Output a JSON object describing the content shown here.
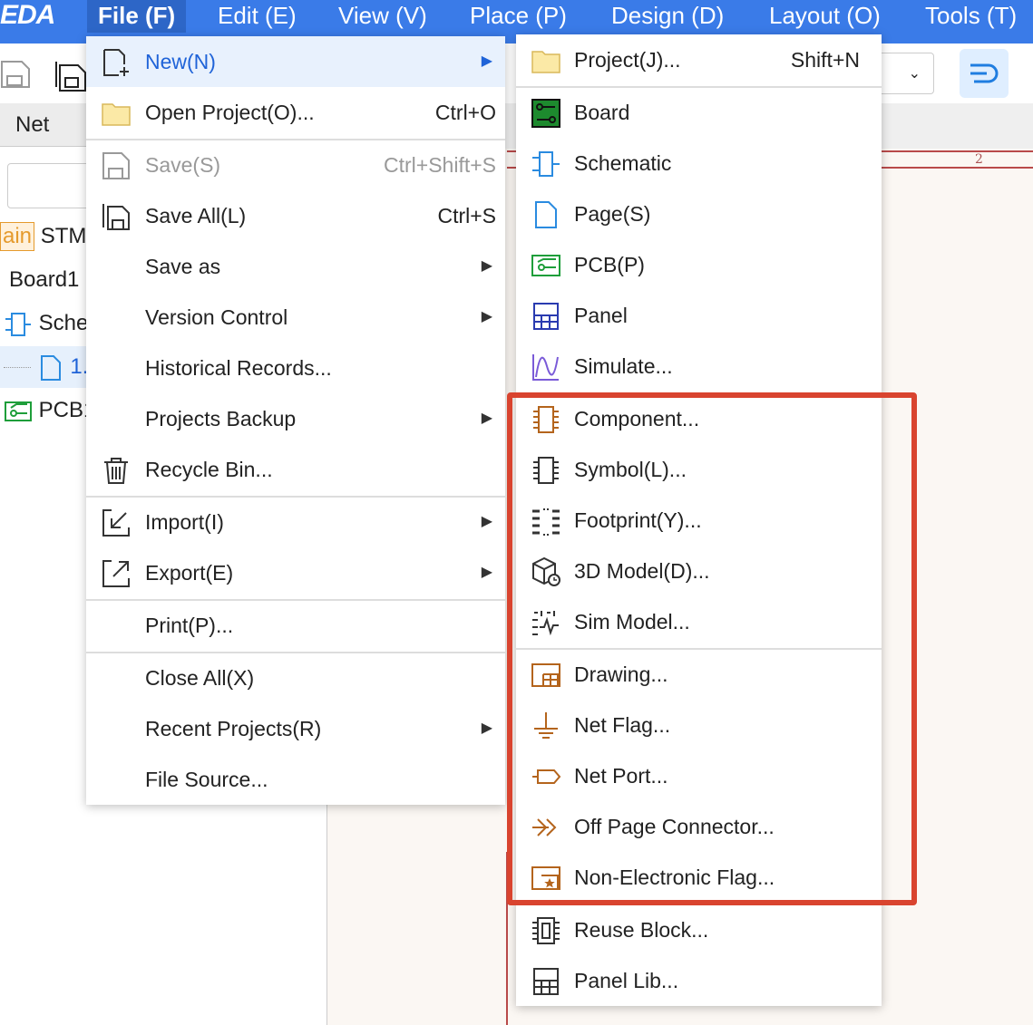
{
  "app": {
    "logo": "EDA"
  },
  "menubar": {
    "items": [
      {
        "label": "File (F)"
      },
      {
        "label": "Edit (E)"
      },
      {
        "label": "View (V)"
      },
      {
        "label": "Place (P)"
      },
      {
        "label": "Design (D)"
      },
      {
        "label": "Layout (O)"
      },
      {
        "label": "Tools (T)"
      }
    ]
  },
  "toolbar": {
    "right_select": "ch"
  },
  "left_panel": {
    "tab": "Net",
    "tree": [
      {
        "badge": "ain",
        "label": "STM"
      },
      {
        "label": "Board1"
      },
      {
        "label": "Sche"
      },
      {
        "label": "1."
      },
      {
        "label": "PCB1"
      }
    ]
  },
  "canvas": {
    "frame_number": "2"
  },
  "file_menu": {
    "items": [
      {
        "label": "New(N)",
        "shortcut": "",
        "icon": "new-file-icon"
      },
      {
        "label": "Open Project(O)...",
        "shortcut": "Ctrl+O",
        "icon": "folder-icon"
      },
      {
        "label": "Save(S)",
        "shortcut": "Ctrl+Shift+S",
        "icon": "save-icon"
      },
      {
        "label": "Save All(L)",
        "shortcut": "Ctrl+S",
        "icon": "save-all-icon"
      },
      {
        "label": "Save as"
      },
      {
        "label": "Version Control"
      },
      {
        "label": "Historical Records..."
      },
      {
        "label": "Projects Backup"
      },
      {
        "label": "Recycle Bin...",
        "icon": "trash-icon"
      },
      {
        "label": "Import(I)",
        "icon": "import-icon"
      },
      {
        "label": "Export(E)",
        "icon": "export-icon"
      },
      {
        "label": "Print(P)..."
      },
      {
        "label": "Close All(X)"
      },
      {
        "label": "Recent Projects(R)"
      },
      {
        "label": "File Source..."
      }
    ]
  },
  "new_menu": {
    "items": [
      {
        "label": "Project(J)...",
        "shortcut": "Shift+N",
        "icon": "folder-icon"
      },
      {
        "label": "Board",
        "icon": "board-icon"
      },
      {
        "label": "Schematic",
        "icon": "schematic-icon"
      },
      {
        "label": "Page(S)",
        "icon": "page-icon"
      },
      {
        "label": "PCB(P)",
        "icon": "pcb-icon"
      },
      {
        "label": "Panel",
        "icon": "panel-icon"
      },
      {
        "label": "Simulate...",
        "icon": "simulate-icon"
      },
      {
        "label": "Component...",
        "icon": "component-icon"
      },
      {
        "label": "Symbol(L)...",
        "icon": "symbol-icon"
      },
      {
        "label": "Footprint(Y)...",
        "icon": "footprint-icon"
      },
      {
        "label": "3D Model(D)...",
        "icon": "3d-model-icon"
      },
      {
        "label": "Sim Model...",
        "icon": "sim-model-icon"
      },
      {
        "label": "Drawing...",
        "icon": "drawing-icon"
      },
      {
        "label": "Net Flag...",
        "icon": "net-flag-icon"
      },
      {
        "label": "Net Port...",
        "icon": "net-port-icon"
      },
      {
        "label": "Off Page Connector...",
        "icon": "off-page-connector-icon"
      },
      {
        "label": "Non-Electronic Flag...",
        "icon": "non-electronic-flag-icon"
      },
      {
        "label": "Reuse Block...",
        "icon": "reuse-block-icon"
      },
      {
        "label": "Panel Lib...",
        "icon": "panel-lib-icon"
      }
    ]
  },
  "colors": {
    "accent": "#3a7be8",
    "highlight_box": "#d9442f",
    "menu_active": "#1f63d8"
  }
}
